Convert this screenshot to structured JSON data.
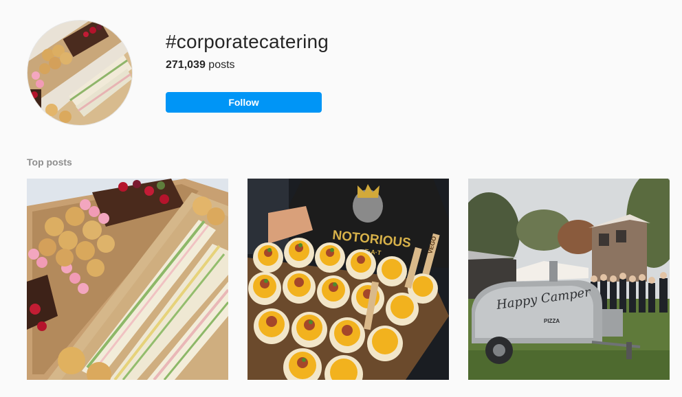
{
  "hashtag": {
    "title": "#corporatecatering",
    "post_count": "271,039",
    "posts_word": "posts",
    "follow_label": "Follow",
    "avatar_icon": "catering-platter-photo"
  },
  "top_posts": {
    "heading": "Top posts",
    "items": [
      {
        "image": "sandwich-and-pastry-catering-box-photo"
      },
      {
        "image": "loaded-fries-tray-photo",
        "shirt_text": "NOTORIOUS",
        "shirt_subtext": "E·A·T",
        "fork_text": "VEGO"
      },
      {
        "image": "pizza-trailer-at-event-photo",
        "trailer_text": "Happy Camper",
        "trailer_subtext": "PIZZA"
      }
    ]
  },
  "colors": {
    "accent": "#0095f6",
    "text": "#262626",
    "muted": "#8e8e8e",
    "background": "#fafafa"
  }
}
